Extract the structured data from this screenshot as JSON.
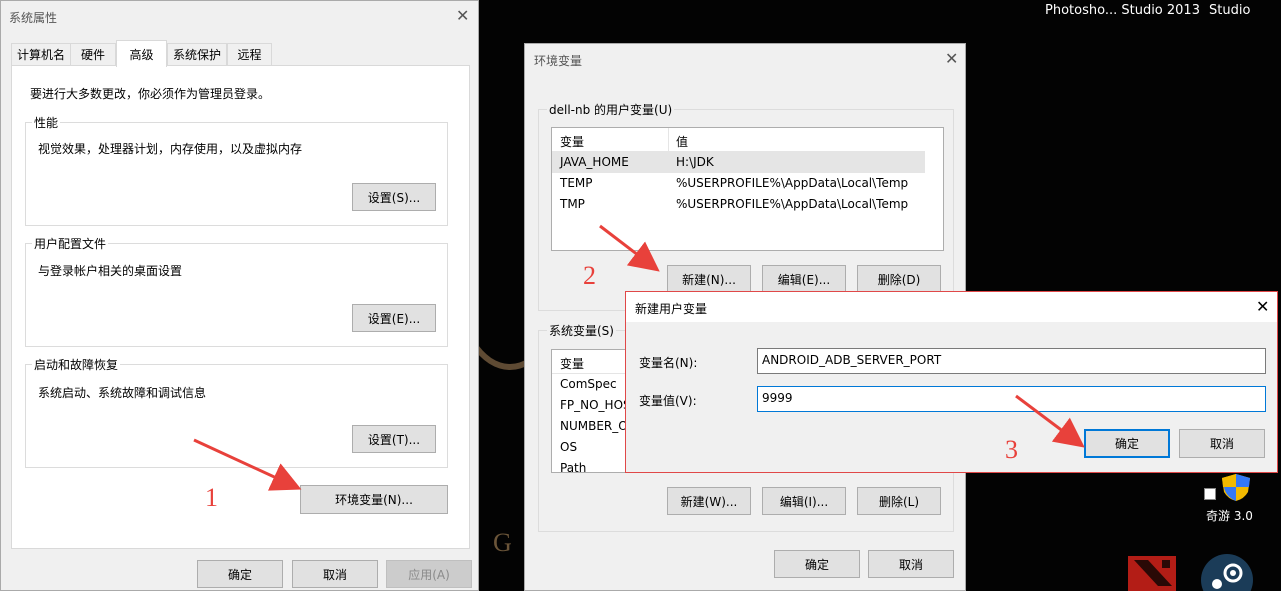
{
  "taskbar": {
    "items": [
      "Photosho... Studio 2013",
      "Studio"
    ]
  },
  "desktop": {
    "icons": [
      {
        "label": "奇游 3.0"
      }
    ],
    "brand_letter": "G"
  },
  "system_properties": {
    "title": "系统属性",
    "tabs": [
      "计算机名",
      "硬件",
      "高级",
      "系统保护",
      "远程"
    ],
    "selected_tab": "高级",
    "admin_note": "要进行大多数更改，你必须作为管理员登录。",
    "performance": {
      "label": "性能",
      "description": "视觉效果，处理器计划，内存使用，以及虚拟内存",
      "button": "设置(S)..."
    },
    "user_profiles": {
      "label": "用户配置文件",
      "description": "与登录帐户相关的桌面设置",
      "button": "设置(E)..."
    },
    "startup_recovery": {
      "label": "启动和故障恢复",
      "description": "系统启动、系统故障和调试信息",
      "button": "设置(T)..."
    },
    "env_button": "环境变量(N)...",
    "ok": "确定",
    "cancel": "取消",
    "apply": "应用(A)"
  },
  "env_vars": {
    "title": "环境变量",
    "user_group_label": "dell-nb 的用户变量(U)",
    "user_columns": [
      "变量",
      "值"
    ],
    "user_rows": [
      {
        "name": "JAVA_HOME",
        "value": "H:\\JDK"
      },
      {
        "name": "TEMP",
        "value": "%USERPROFILE%\\AppData\\Local\\Temp"
      },
      {
        "name": "TMP",
        "value": "%USERPROFILE%\\AppData\\Local\\Temp"
      }
    ],
    "user_buttons": {
      "new": "新建(N)...",
      "edit": "编辑(E)...",
      "delete": "删除(D)"
    },
    "system_group_label": "系统变量(S)",
    "system_columns": [
      "变量"
    ],
    "system_rows": [
      "ComSpec",
      "FP_NO_HOS",
      "NUMBER_O",
      "OS",
      "Path"
    ],
    "system_buttons": {
      "new": "新建(W)...",
      "edit": "编辑(I)...",
      "delete": "删除(L)"
    },
    "ok": "确定",
    "cancel": "取消"
  },
  "new_var_dialog": {
    "title": "新建用户变量",
    "name_label": "变量名(N):",
    "name_value": "ANDROID_ADB_SERVER_PORT",
    "value_label": "变量值(V):",
    "value_value": "9999",
    "ok": "确定",
    "cancel": "取消"
  },
  "annotations": {
    "steps": [
      "1",
      "2",
      "3"
    ],
    "color": "#e8413b"
  },
  "colors": {
    "accent": "#0078d7",
    "dialog_border_active": "#e04848"
  }
}
